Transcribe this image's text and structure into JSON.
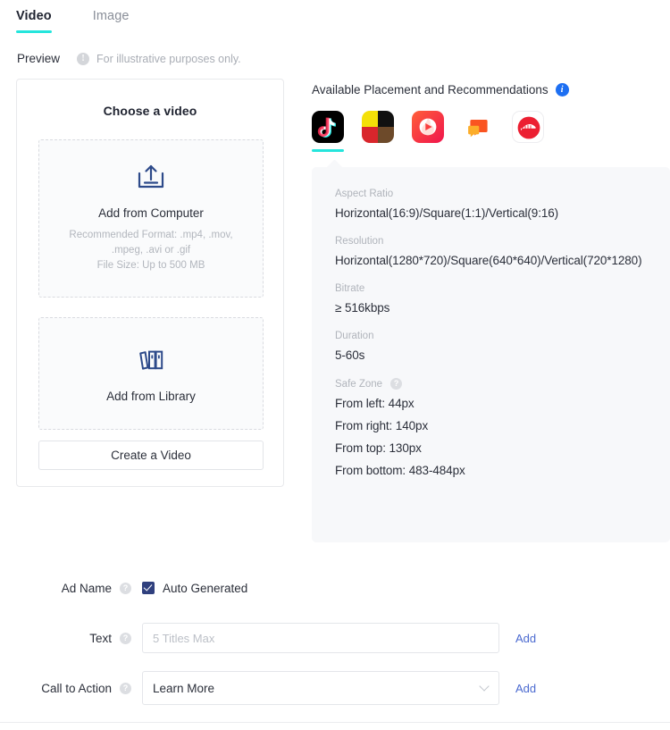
{
  "tabs": [
    {
      "label": "Video",
      "active": true
    },
    {
      "label": "Image",
      "active": false
    }
  ],
  "preview": {
    "label": "Preview",
    "warn_icon": "exclamation-circle-icon",
    "note": "For illustrative purposes only."
  },
  "left_card": {
    "title": "Choose a video",
    "upload": {
      "icon": "upload-tray-icon",
      "title": "Add from Computer",
      "hint_line1": "Recommended Format: .mp4, .mov,",
      "hint_line2": ".mpeg, .avi or .gif",
      "hint_line3": "File Size: Up to 500 MB"
    },
    "library": {
      "icon": "books-library-icon",
      "title": "Add from Library"
    },
    "create_button": "Create a Video"
  },
  "placements": {
    "title": "Available Placement and Recommendations",
    "info_icon": "info-circle-icon",
    "items": [
      {
        "name": "tiktok",
        "icon": "tiktok-icon",
        "selected": true
      },
      {
        "name": "tiktok-sister-apps",
        "icon": "sister-apps-grid-icon",
        "selected": false
      },
      {
        "name": "helo",
        "icon": "helo-flame-play-icon",
        "selected": false
      },
      {
        "name": "news-feed-app",
        "icon": "chat-bubble-icon",
        "selected": false
      },
      {
        "name": "pangle",
        "icon": "pangle-bird-icon",
        "selected": false
      }
    ]
  },
  "specs": [
    {
      "label": "Aspect Ratio",
      "has_help": false,
      "values": [
        "Horizontal(16:9)/Square(1:1)/Vertical(9:16)"
      ]
    },
    {
      "label": "Resolution",
      "has_help": false,
      "values": [
        "Horizontal(1280*720)/Square(640*640)/Vertical(720*1280)"
      ]
    },
    {
      "label": "Bitrate",
      "has_help": false,
      "values": [
        "≥ 516kbps"
      ]
    },
    {
      "label": "Duration",
      "has_help": false,
      "values": [
        "5-60s"
      ]
    },
    {
      "label": "Safe Zone",
      "has_help": true,
      "help_icon": "question-circle-icon",
      "values": [
        "From left: 44px",
        "From right: 140px",
        "From top: 130px",
        "From bottom: 483-484px"
      ]
    }
  ],
  "form": {
    "ad_name": {
      "label": "Ad Name",
      "help_icon": "question-circle-icon",
      "checkbox_checked": true,
      "checkbox_label": "Auto Generated"
    },
    "text": {
      "label": "Text",
      "help_icon": "question-circle-icon",
      "value": "",
      "placeholder": "5 Titles Max",
      "add_label": "Add"
    },
    "call_to_action": {
      "label": "Call to Action",
      "help_icon": "question-circle-icon",
      "selected": "Learn More",
      "chevron_icon": "chevron-down-icon",
      "add_label": "Add"
    }
  },
  "colors": {
    "accent_teal": "#25e5dc",
    "link_blue": "#4b6ad0",
    "info_blue": "#1d6ff2",
    "checkbox_navy": "#30407e",
    "icon_navy": "#2d4a8a",
    "panel_bg": "#f7f8fa"
  }
}
